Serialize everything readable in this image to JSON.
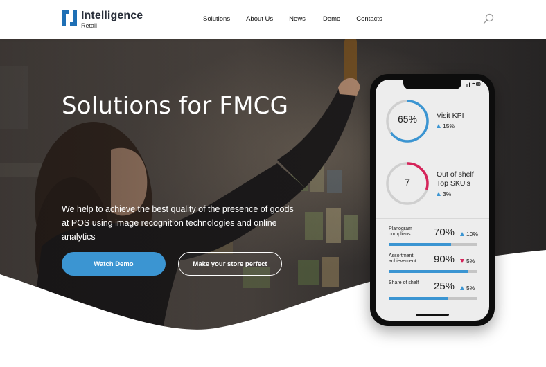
{
  "brand": {
    "name": "Intelligence",
    "sub": "Retail",
    "color": "#1e6fb5"
  },
  "nav": {
    "items": [
      "Solutions",
      "About Us",
      "News",
      "Demo",
      "Contacts"
    ]
  },
  "hero": {
    "title": "Solutions for FMCG",
    "text": "We help to achieve the best quality of the presence of goods at POS using image recognition technologies and online analytics",
    "primary_button": "Watch Demo",
    "secondary_button": "Make your store perfect",
    "accent_color": "#3b95d2"
  },
  "phone": {
    "kpis": [
      {
        "value": "65%",
        "label": "Visit KPI",
        "delta": "15%",
        "trend": "up",
        "fraction": 0.65,
        "color": "#3b95d2"
      },
      {
        "value": "7",
        "label_line1": "Out of shelf",
        "label_line2": "Top SKU's",
        "delta": "3%",
        "trend": "up",
        "fraction": 0.3,
        "color": "#d6245a"
      }
    ],
    "metrics": [
      {
        "label": "Planogram complians",
        "value": "70%",
        "delta": "10%",
        "trend": "up",
        "fraction": 0.7
      },
      {
        "label": "Assortment achievement",
        "value": "90%",
        "delta": "5%",
        "trend": "down",
        "fraction": 0.9
      },
      {
        "label": "Share of shelf",
        "value": "25%",
        "delta": "5%",
        "trend": "up",
        "fraction": 0.67
      }
    ]
  }
}
